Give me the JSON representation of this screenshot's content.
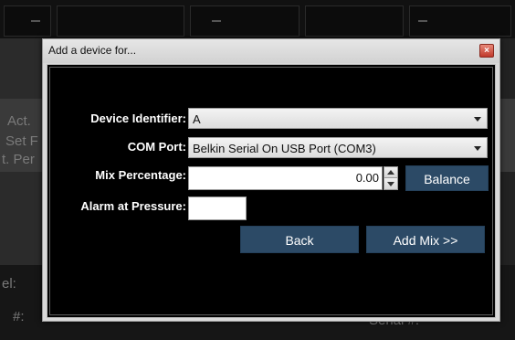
{
  "background": {
    "left_labels": [
      "Act.",
      "Set F",
      "t. Per",
      "el:",
      "#:"
    ],
    "right_label": "Serial #:"
  },
  "dialog": {
    "title": "Add a device for...",
    "close_glyph": "×",
    "device_identifier": {
      "label": "Device Identifier:",
      "value": "A"
    },
    "com_port": {
      "label": "COM Port:",
      "value": "Belkin Serial On USB Port (COM3)"
    },
    "mix_percentage": {
      "label": "Mix Percentage:",
      "value": "0.00"
    },
    "balance_button": "Balance",
    "alarm_at_pressure": {
      "label": "Alarm at Pressure:",
      "value": ""
    },
    "back_button": "Back",
    "add_mix_button": "Add Mix >>"
  },
  "colors": {
    "button_blue": "#2c4a66",
    "dialog_chrome": "#d9d9d9",
    "client_background": "#000000",
    "close_red": "#c0392b"
  },
  "icons": [
    "close-icon",
    "chevron-down-icon",
    "spin-up-icon",
    "spin-down-icon"
  ]
}
